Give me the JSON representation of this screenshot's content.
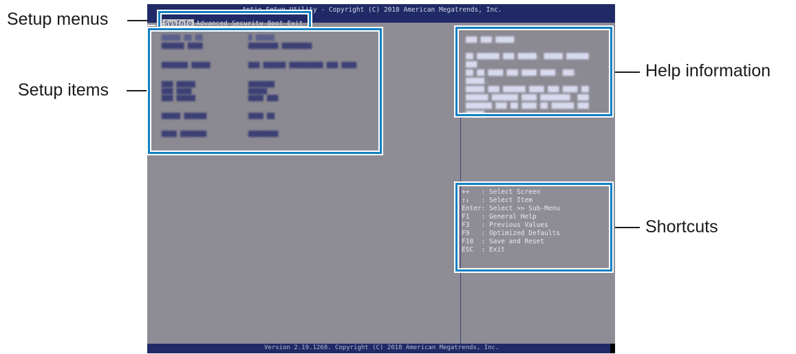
{
  "annotations": {
    "setup_menus": "Setup menus",
    "setup_items": "Setup items",
    "help_information": "Help information",
    "shortcuts": "Shortcuts"
  },
  "bios": {
    "title": "Aptio Setup Utility - Copyright (C) 2018 American Megatrends, Inc.",
    "version": "Version 2.19.1268. Copyright (C) 2018 American Megatrends, Inc.",
    "menus": [
      "SysInfo",
      "Advanced",
      "Security",
      "Boot",
      "Exit"
    ],
    "active_menu": "SysInfo",
    "colors": {
      "header": "#1f2a66",
      "panel": "#8e8c95",
      "highlight": "#1180c3"
    }
  },
  "shortcuts": [
    "++   : Select Screen",
    "↑↓   : Select Item",
    "Enter: Select >> Sub-Menu",
    "F1   : General Help",
    "F3   : Previous Values",
    "F9   : Optimized Defaults",
    "F10  : Save and Reset",
    "ESC  : Exit"
  ]
}
